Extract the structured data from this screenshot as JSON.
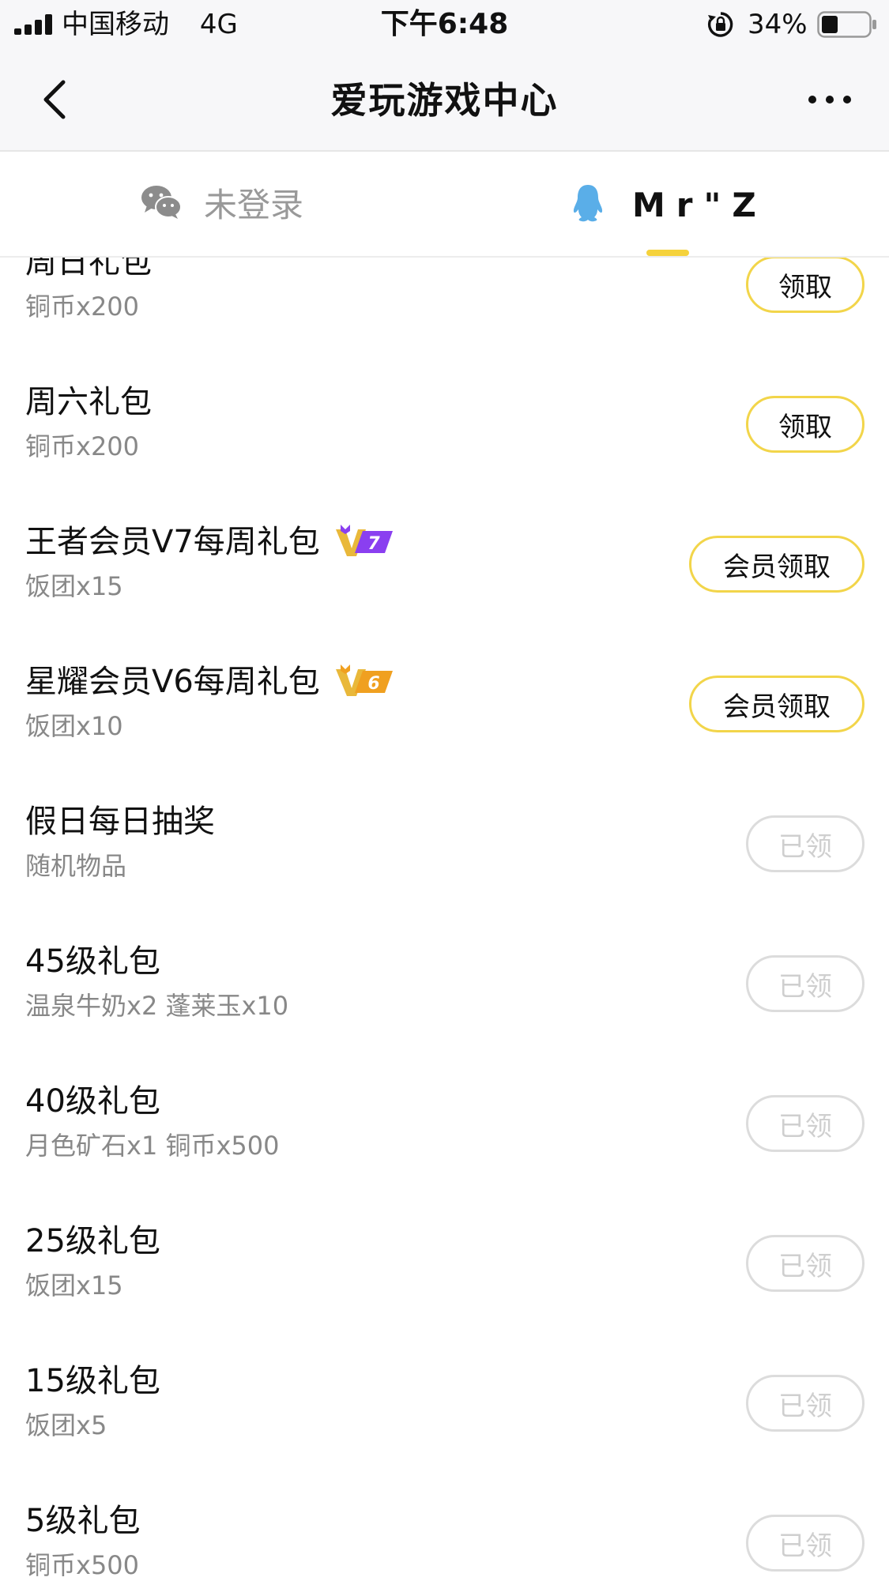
{
  "status_bar": {
    "carrier": "中国移动",
    "network": "4G",
    "time": "下午6:48",
    "battery_percent": "34%",
    "battery_level": 0.34
  },
  "nav": {
    "title": "爱玩游戏中心"
  },
  "tabs": {
    "wechat_label": "未登录",
    "qq_label": "Mr\"Z",
    "active": "qq",
    "accent_color": "#f5d23c"
  },
  "gifts": [
    {
      "title": "周日礼包",
      "subtitle": "铜币x200",
      "button": "领取",
      "state": "available"
    },
    {
      "title": "周六礼包",
      "subtitle": "铜币x200",
      "button": "领取",
      "state": "available"
    },
    {
      "title": "王者会员V7每周礼包",
      "subtitle": "饭团x15",
      "button": "会员领取",
      "state": "vip",
      "badge": "V7"
    },
    {
      "title": "星耀会员V6每周礼包",
      "subtitle": "饭团x10",
      "button": "会员领取",
      "state": "vip",
      "badge": "V6"
    },
    {
      "title": "假日每日抽奖",
      "subtitle": "随机物品",
      "button": "已领",
      "state": "claimed"
    },
    {
      "title": "45级礼包",
      "subtitle": "温泉牛奶x2 蓬莱玉x10",
      "button": "已领",
      "state": "claimed"
    },
    {
      "title": "40级礼包",
      "subtitle": "月色矿石x1 铜币x500",
      "button": "已领",
      "state": "claimed"
    },
    {
      "title": "25级礼包",
      "subtitle": "饭团x15",
      "button": "已领",
      "state": "claimed"
    },
    {
      "title": "15级礼包",
      "subtitle": "饭团x5",
      "button": "已领",
      "state": "claimed"
    },
    {
      "title": "5级礼包",
      "subtitle": "铜币x500",
      "button": "已领",
      "state": "claimed"
    }
  ],
  "colors": {
    "button_border_active": "#f2d54a",
    "button_border_claimed": "#dcdcdc",
    "vip7_color": "#8a3ff0",
    "vip6_color": "#f0a020"
  }
}
